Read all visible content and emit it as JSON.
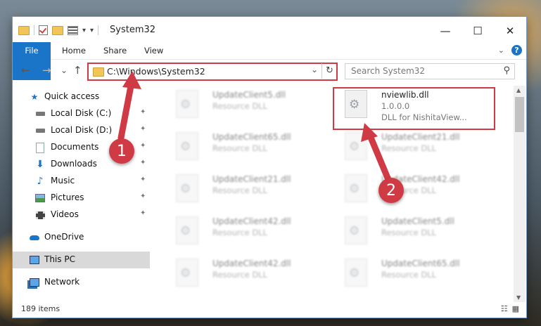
{
  "window": {
    "title": "System32",
    "min_label": "—",
    "max_label": "☐",
    "close_label": "✕"
  },
  "quick_access": {
    "dropdown_label": "▾",
    "customize_label": "▾"
  },
  "ribbon": {
    "tabs": [
      "File",
      "Home",
      "Share",
      "View"
    ],
    "collapse_label": "⌄",
    "help_label": "?"
  },
  "nav": {
    "back": "←",
    "forward": "→",
    "recent": "⌄",
    "up": "↑"
  },
  "address": {
    "path": "C:\\Windows\\System32",
    "dropdown": "⌄",
    "refresh": "↻"
  },
  "search": {
    "placeholder": "Search System32",
    "icon": "search-icon"
  },
  "sidebar": {
    "items": [
      {
        "label": "Quick access",
        "icon": "star-icon",
        "pin": ""
      },
      {
        "label": "Local Disk (C:)",
        "icon": "drive-icon",
        "pin": "📌"
      },
      {
        "label": "Local Disk (D:)",
        "icon": "drive-icon",
        "pin": "📌"
      },
      {
        "label": "Documents",
        "icon": "documents-icon",
        "pin": "📌"
      },
      {
        "label": "Downloads",
        "icon": "downloads-icon",
        "pin": "📌"
      },
      {
        "label": "Music",
        "icon": "music-icon",
        "pin": "📌"
      },
      {
        "label": "Pictures",
        "icon": "pictures-icon",
        "pin": "📌"
      },
      {
        "label": "Videos",
        "icon": "videos-icon",
        "pin": "📌"
      },
      {
        "label": "OneDrive",
        "icon": "cloud-icon",
        "pin": ""
      },
      {
        "label": "This PC",
        "icon": "computer-icon",
        "pin": ""
      },
      {
        "label": "Network",
        "icon": "network-icon",
        "pin": ""
      }
    ]
  },
  "files": {
    "left": [
      {
        "name": "UpdateClient5.dll",
        "type": "Resource DLL"
      },
      {
        "name": "UpdateClient65.dll",
        "type": "Resource DLL"
      },
      {
        "name": "UpdateClient21.dll",
        "type": "Resource DLL"
      },
      {
        "name": "UpdateClient42.dll",
        "type": "Resource DLL"
      },
      {
        "name": "UpdateClient42.dll",
        "type": "Resource DLL"
      }
    ],
    "highlighted": {
      "name": "nviewlib.dll",
      "version": "1.0.0.0",
      "desc": "DLL for NishitaView..."
    },
    "right": [
      {
        "name": "UpdateClient21.dll",
        "type": "Resource DLL"
      },
      {
        "name": "UpdateClient42.dll",
        "type": "Resource DLL"
      },
      {
        "name": "UpdateClient5.dll",
        "type": "Resource DLL"
      },
      {
        "name": "UpdateClient65.dll",
        "type": "Resource DLL"
      }
    ]
  },
  "status": {
    "count": "189 items",
    "details_view": "☷",
    "tiles_view": "▦"
  },
  "callouts": {
    "one": "1",
    "two": "2"
  },
  "colors": {
    "accent": "#1a74c8",
    "highlight": "#d03a45"
  }
}
